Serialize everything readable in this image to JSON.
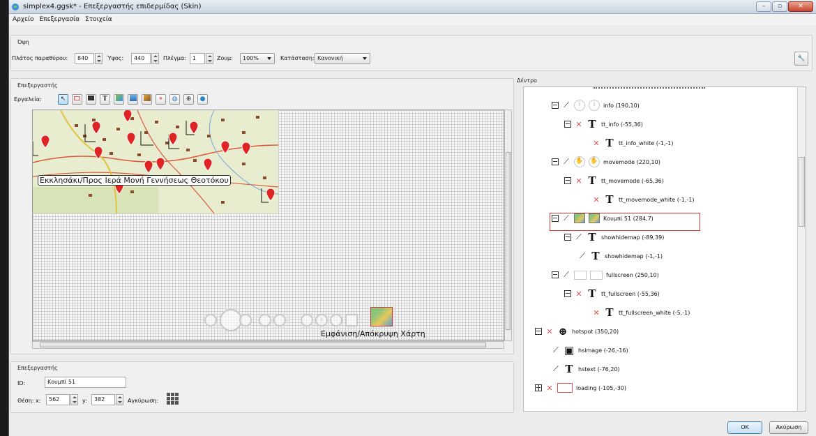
{
  "window": {
    "title": "simplex4.ggsk* - Επεξεργαστής επιδερμίδας (Skin)"
  },
  "menu": [
    "Αρχείο",
    "Επεξεργασία",
    "Στοιχεία"
  ],
  "view": {
    "group_title": "Όψη",
    "width_label": "Πλάτος παραθύρου:",
    "width_value": "840",
    "height_label": "Ύψος:",
    "height_value": "440",
    "grid_label": "Πλέγμα:",
    "grid_value": "1",
    "zoom_label": "Ζουμ:",
    "zoom_value": "100%",
    "state_label": "Κατάσταση:",
    "state_value": "Κανονική"
  },
  "editor": {
    "group_title": "Επεξεργαστής",
    "tools_label": "Εργαλεία:",
    "map_caption": "Εκκλησάκι/Προς Ιερά Μονή Γεννήσεως Θεοτόκου",
    "hover_label": "Εμφάνιση/Απόκρυψη Χάρτη"
  },
  "properties": {
    "group_title": "Επεξεργαστής",
    "id_label": "ID:",
    "id_value": "Κουμπί 51",
    "pos_label": "Θέση: x:",
    "x_value": "562",
    "y_label": "y:",
    "y_value": "382",
    "anchor_label": "Αγκύρωση:"
  },
  "tree": {
    "title": "Δέντρο",
    "rows": [
      {
        "label": "info (190,10)",
        "icon": "info-icon",
        "visible": true,
        "expander": "minus",
        "kind": "ghost"
      },
      {
        "label": "tt_info (-55,36)",
        "icon": "text-icon",
        "visible": false,
        "expander": "minus",
        "kind": "text"
      },
      {
        "label": "tt_info_white (-1,-1)",
        "icon": "text-icon",
        "visible": false,
        "expander": "none",
        "kind": "text"
      },
      {
        "label": "movemode (220,10)",
        "icon": "hand-icon",
        "visible": true,
        "expander": "minus",
        "kind": "ghost"
      },
      {
        "label": "tt_movemode (-65,36)",
        "icon": "text-icon",
        "visible": false,
        "expander": "minus",
        "kind": "text"
      },
      {
        "label": "tt_movemode_white (-1,-1)",
        "icon": "text-icon",
        "visible": false,
        "expander": "none",
        "kind": "text"
      },
      {
        "label": "Κουμπί 51 (284,7)",
        "icon": "map-icon",
        "visible": true,
        "expander": "minus",
        "kind": "map"
      },
      {
        "label": "showhidemap (-89,39)",
        "icon": "text-icon",
        "visible": true,
        "expander": "minus",
        "kind": "text"
      },
      {
        "label": "showhidemap (-1,-1)",
        "icon": "text-icon",
        "visible": true,
        "expander": "none",
        "kind": "text"
      },
      {
        "label": "fullscreen (250,10)",
        "icon": "fullscreen-icon",
        "visible": true,
        "expander": "minus",
        "kind": "ghostsq"
      },
      {
        "label": "tt_fullscreen (-55,36)",
        "icon": "text-icon",
        "visible": false,
        "expander": "minus",
        "kind": "text"
      },
      {
        "label": "tt_fullscreen_white (-5,-1)",
        "icon": "text-icon",
        "visible": false,
        "expander": "none",
        "kind": "text"
      },
      {
        "label": "hotspot (350,20)",
        "icon": "crosshair-icon",
        "visible": false,
        "expander": "minus",
        "kind": "crosshair"
      },
      {
        "label": "hsimage (-26,-16)",
        "icon": "image-icon",
        "visible": true,
        "expander": "none",
        "kind": "image"
      },
      {
        "label": "hstext (-76,20)",
        "icon": "text-icon",
        "visible": true,
        "expander": "none",
        "kind": "text"
      },
      {
        "label": "loading (-105,-30)",
        "icon": "rectangle-icon",
        "visible": false,
        "expander": "plus",
        "kind": "rect"
      }
    ]
  },
  "buttons": {
    "ok": "OK",
    "cancel": "Ακύρωση"
  }
}
